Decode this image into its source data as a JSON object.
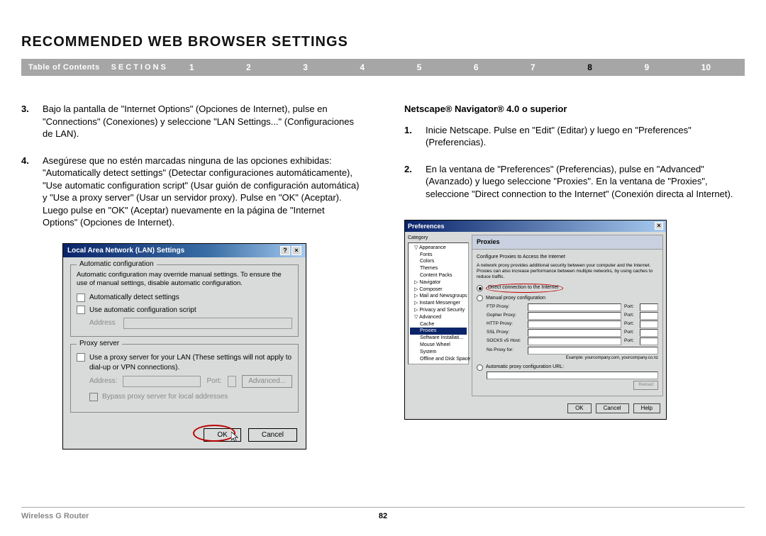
{
  "title": "RECOMMENDED WEB BROWSER SETTINGS",
  "nav": {
    "toc": "Table of Contents",
    "sections": "SECTIONS",
    "numbers": [
      "1",
      "2",
      "3",
      "4",
      "5",
      "6",
      "7",
      "8",
      "9",
      "10"
    ],
    "active_index": 7
  },
  "left": {
    "p3_num": "3.",
    "p3": "Bajo la pantalla de \"Internet Options\" (Opciones de Internet), pulse en \"Connections\" (Conexiones) y seleccione \"LAN Settings...\" (Configuraciones de LAN).",
    "p4_num": "4.",
    "p4": "Asegúrese que no estén marcadas ninguna de las opciones exhibidas: \"Automatically detect settings\" (Detectar configuraciones automáticamente), \"Use automatic configuration script\" (Usar guión de configuración automática) y \"Use a proxy server\" (Usar un servidor proxy). Pulse en \"OK\" (Aceptar). Luego pulse en \"OK\" (Aceptar) nuevamente en la página de \"Internet Options\" (Opciones de Internet)."
  },
  "lan_dialog": {
    "title": "Local Area Network (LAN) Settings",
    "fs1_legend": "Automatic configuration",
    "fs1_desc": "Automatic configuration may override manual settings. To ensure the use of manual settings, disable automatic configuration.",
    "chk1": "Automatically detect settings",
    "chk2": "Use automatic configuration script",
    "addr_lbl": "Address",
    "fs2_legend": "Proxy server",
    "fs2_chk": "Use a proxy server for your LAN (These settings will not apply to dial-up or VPN connections).",
    "addr2_lbl": "Address:",
    "port_lbl": "Port:",
    "advanced": "Advanced...",
    "bypass": "Bypass proxy server for local addresses",
    "ok": "OK",
    "cancel": "Cancel"
  },
  "right": {
    "subhead": "Netscape® Navigator® 4.0 o superior",
    "p1_num": "1.",
    "p1": "Inicie Netscape. Pulse en \"Edit\" (Editar) y luego en \"Preferences\" (Preferencias).",
    "p2_num": "2.",
    "p2": "En la ventana de \"Preferences\" (Preferencias), pulse en \"Advanced\" (Avanzado) y luego seleccione \"Proxies\". En la ventana de \"Proxies\", seleccione \"Direct connection to the Internet\" (Conexión directa al Internet)."
  },
  "ns_dialog": {
    "title": "Preferences",
    "category": "Category",
    "tree": [
      "▽ Appearance",
      " Fonts",
      " Colors",
      " Themes",
      " Content Packs",
      "▷ Navigator",
      "▷ Composer",
      "▷ Mail and Newsgroups",
      "▷ Instant Messenger",
      "▷ Privacy and Security",
      "▽ Advanced",
      " Cache",
      " Proxies",
      " Software Installati...",
      " Mouse Wheel",
      " System",
      " Offline and Disk Space"
    ],
    "tree_sel": 12,
    "panel_head": "Proxies",
    "desc": "Configure Proxies to Access the Internet",
    "sub": "A network proxy provides additional security between your computer and the Internet. Proxies can also increase performance between multiple networks, by using caches to reduce traffic.",
    "r1": "Direct connection to the Internet",
    "r2": "Manual proxy configuration",
    "fields": [
      {
        "lbl": "FTP Proxy:",
        "port": "Port:"
      },
      {
        "lbl": "Gopher Proxy:",
        "port": "Port:"
      },
      {
        "lbl": "HTTP Proxy:",
        "port": "Port:"
      },
      {
        "lbl": "SSL Proxy:",
        "port": "Port:"
      },
      {
        "lbl": "SOCKS v5 Host:",
        "port": "Port:"
      }
    ],
    "noproxy_lbl": "No Proxy for:",
    "example": "Example: yourcompany.com, yourcompany.co.nz",
    "r3": "Automatic proxy configuration URL:",
    "reload": "Reload",
    "ok": "OK",
    "cancel": "Cancel",
    "help": "Help"
  },
  "footer": {
    "left": "Wireless G Router",
    "page": "82"
  }
}
